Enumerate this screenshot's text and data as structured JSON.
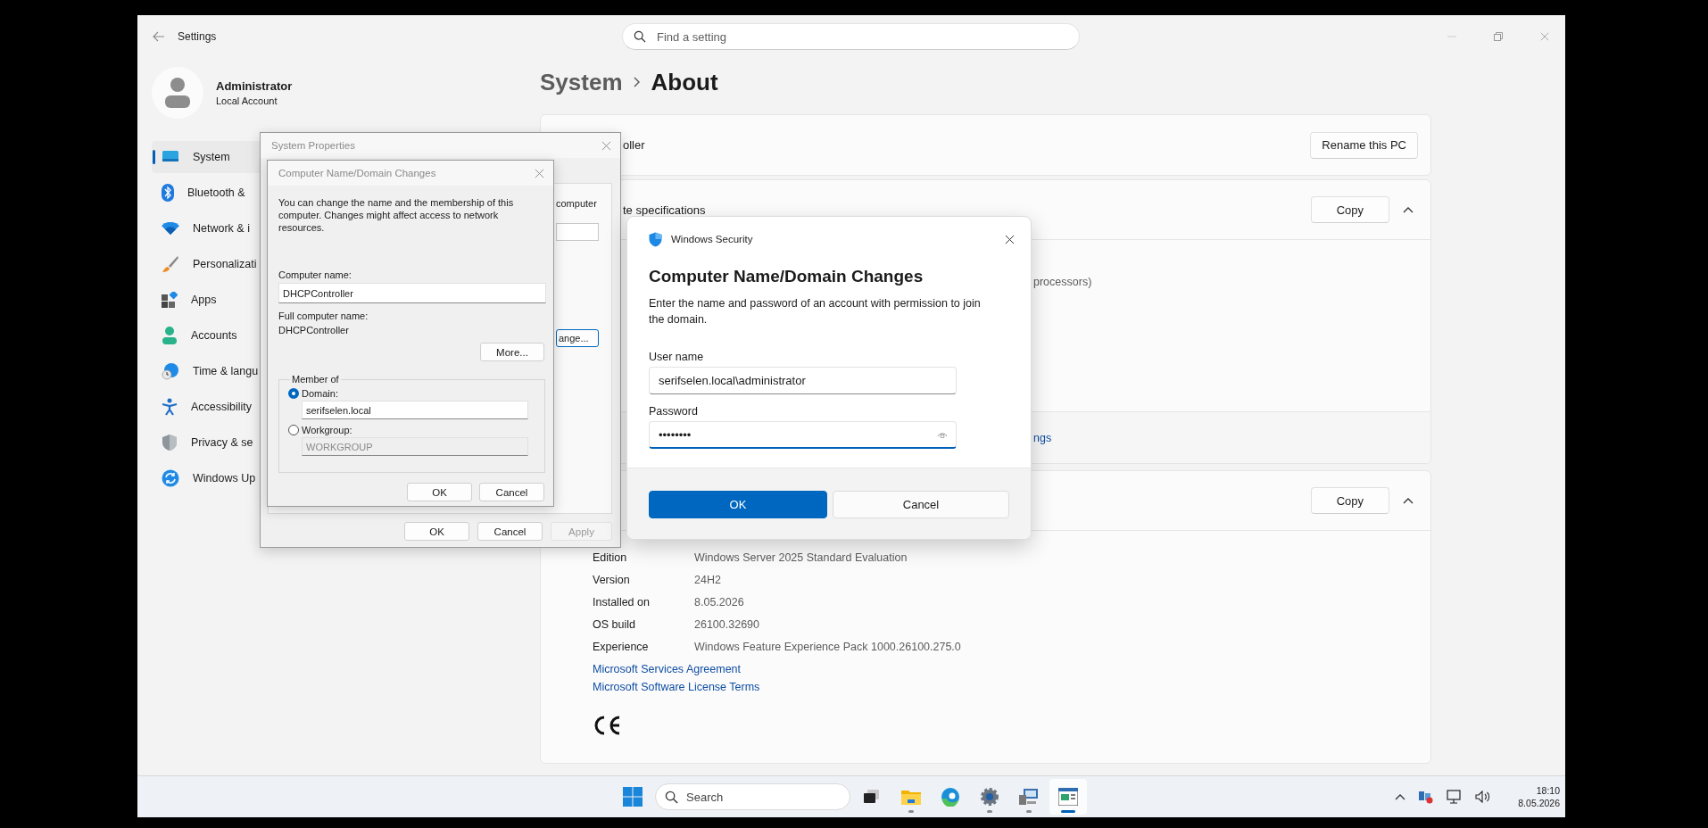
{
  "window": {
    "title": "Settings",
    "search_placeholder": "Find a setting"
  },
  "profile": {
    "name": "Administrator",
    "account": "Local Account"
  },
  "sidebar": {
    "items": [
      {
        "label": "System",
        "selected": true
      },
      {
        "label": "Bluetooth &",
        "selected": false
      },
      {
        "label": "Network & i",
        "selected": false
      },
      {
        "label": "Personalizati",
        "selected": false
      },
      {
        "label": "Apps",
        "selected": false
      },
      {
        "label": "Accounts",
        "selected": false
      },
      {
        "label": "Time & langu",
        "selected": false
      },
      {
        "label": "Accessibility",
        "selected": false
      },
      {
        "label": "Privacy & se",
        "selected": false
      },
      {
        "label": "Windows Up",
        "selected": false
      }
    ]
  },
  "breadcrumb": {
    "parent": "System",
    "current": "About"
  },
  "device_card": {
    "name": "oller",
    "button": "Rename this PC"
  },
  "device_specifications": {
    "title": "te specifications",
    "copy": "Copy",
    "expanded": true,
    "value_fragment": "processors)",
    "related_link": "ngs"
  },
  "windows_specifications": {
    "copy": "Copy",
    "expanded": true,
    "rows": [
      {
        "label": "Edition",
        "value": "Windows Server 2025 Standard Evaluation"
      },
      {
        "label": "Version",
        "value": "24H2"
      },
      {
        "label": "Installed on",
        "value": "8.05.2026"
      },
      {
        "label": "OS build",
        "value": "26100.32690"
      },
      {
        "label": "Experience",
        "value": "Windows Feature Experience Pack 1000.26100.275.0"
      }
    ],
    "links": [
      "Microsoft Services Agreement",
      "Microsoft Software License Terms"
    ]
  },
  "system_properties": {
    "title": "System Properties",
    "fragment": "computer",
    "change_button": {
      "label": "ange...",
      "focused": true
    },
    "buttons": [
      {
        "label": "OK",
        "disabled": false
      },
      {
        "label": "Cancel",
        "disabled": false
      },
      {
        "label": "Apply",
        "disabled": true
      }
    ]
  },
  "computer_name_dialog": {
    "title": "Computer Name/Domain Changes",
    "description": "You can change the name and the membership of this computer. Changes might affect access to network resources.",
    "computer_name_label": "Computer name:",
    "computer_name": "DHCPController",
    "full_name_label": "Full computer name:",
    "full_name": "DHCPController",
    "more_button": "More...",
    "member_of": {
      "title": "Member of",
      "options": [
        {
          "label": "Domain:",
          "selected": true,
          "value": "serifselen.local"
        },
        {
          "label": "Workgroup:",
          "selected": false,
          "value": "WORKGROUP"
        }
      ]
    },
    "buttons": [
      "OK",
      "Cancel"
    ]
  },
  "windows_security": {
    "app": "Windows Security",
    "title": "Computer Name/Domain Changes",
    "description": "Enter the name and password of an account with permission to join the domain.",
    "fields": [
      {
        "label": "User name",
        "value": "serifselen.local\\administrator",
        "focused": false,
        "kind": "text"
      },
      {
        "label": "Password",
        "value": "••••••••",
        "focused": true,
        "kind": "password"
      }
    ],
    "buttons": [
      {
        "label": "OK",
        "kind": "primary"
      },
      {
        "label": "Cancel",
        "kind": "secondary"
      }
    ]
  },
  "taskbar": {
    "search_placeholder": "Search",
    "apps": [
      {
        "running": false,
        "selected": false
      },
      {
        "running": true,
        "selected": false
      },
      {
        "running": false,
        "selected": false
      },
      {
        "running": true,
        "selected": false
      },
      {
        "running": true,
        "selected": false
      },
      {
        "running": true,
        "selected": true
      }
    ],
    "clock": {
      "time": "18:10",
      "date": "8.05.2026"
    }
  }
}
